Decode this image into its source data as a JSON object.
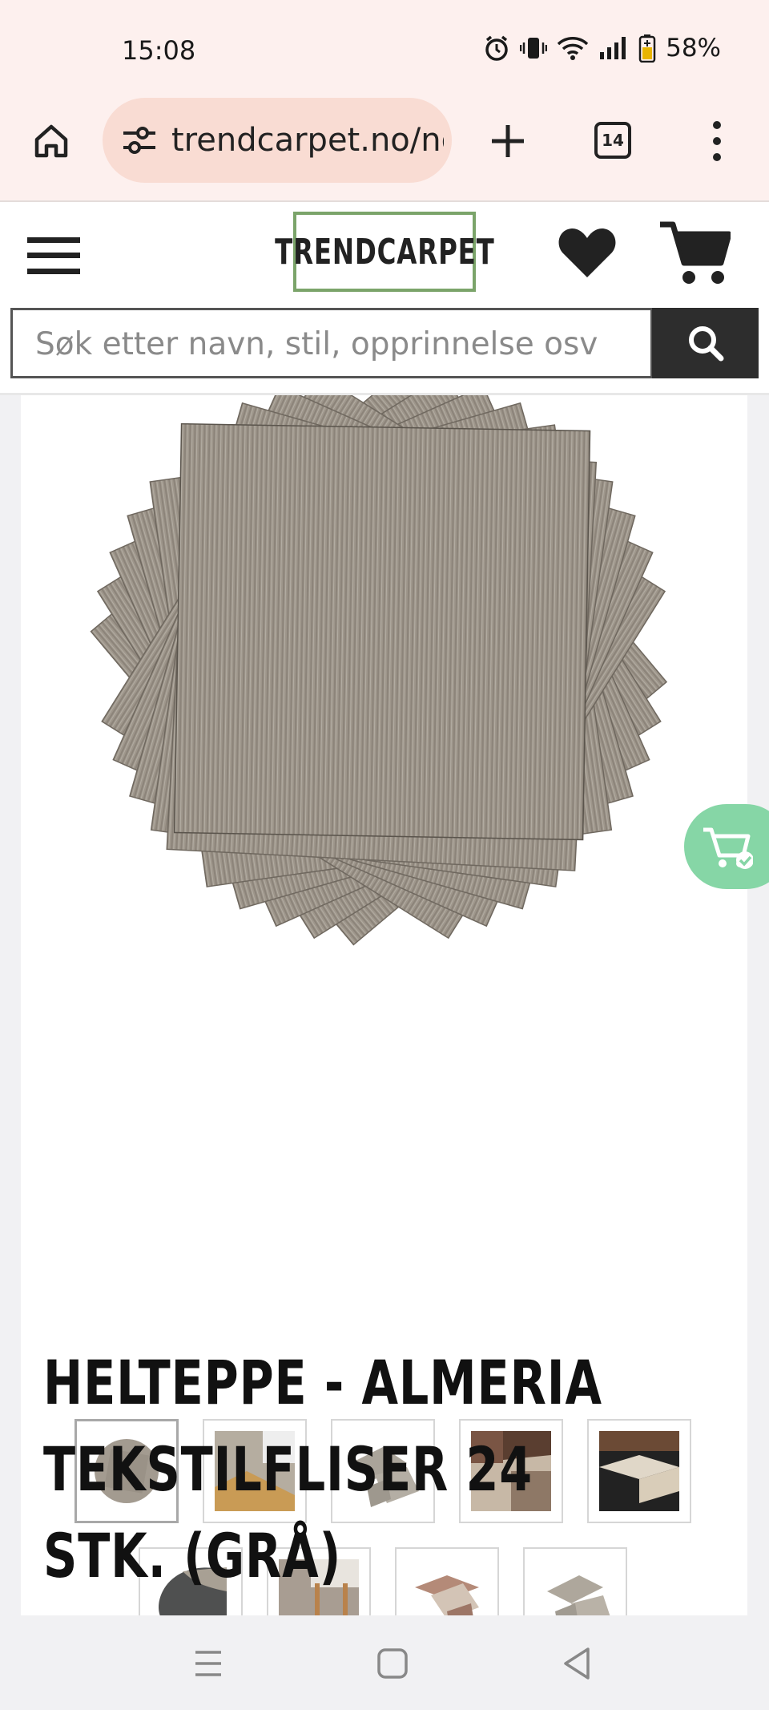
{
  "status_bar": {
    "time": "15:08",
    "battery_percent": "58%"
  },
  "browser": {
    "url": "trendcarpet.no/no",
    "tab_count": "14"
  },
  "site": {
    "logo_text": "TRENDCARPET",
    "search_placeholder": "Søk etter navn, stil, opprinnelse osv",
    "accent_color": "#7ba46a",
    "search_button_color": "#2d2d2d"
  },
  "product": {
    "title": "HELTEPPE - ALMERIA TEKSTILFLISER 24 STK. (GRÅ)",
    "thumbnails": [
      {
        "name": "thumb-stack-tiles",
        "active": true
      },
      {
        "name": "thumb-room-tiles-1",
        "active": false
      },
      {
        "name": "thumb-loose-tiles",
        "active": false
      },
      {
        "name": "thumb-living-room",
        "active": false
      },
      {
        "name": "thumb-checker-floor",
        "active": false
      },
      {
        "name": "thumb-tile-backside",
        "active": false
      },
      {
        "name": "thumb-chair-tiles",
        "active": false
      },
      {
        "name": "thumb-brown-checker",
        "active": false
      },
      {
        "name": "thumb-loose-tiles-2",
        "active": false
      }
    ]
  },
  "fab": {
    "color": "#86d6a6"
  }
}
